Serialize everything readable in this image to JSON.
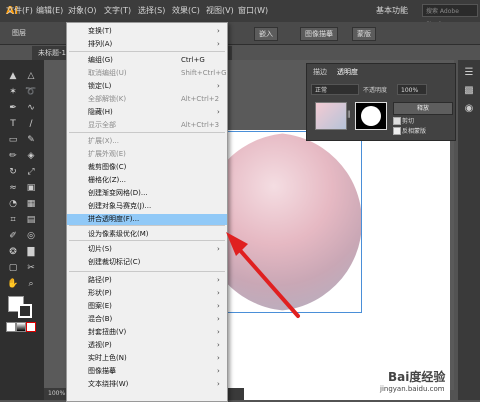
{
  "app": {
    "logo": "Ai"
  },
  "menubar": {
    "items": [
      "文件(F)",
      "编辑(E)",
      "对象(O)",
      "文字(T)",
      "选择(S)",
      "效果(C)",
      "视图(V)",
      "窗口(W)"
    ],
    "workspace": "基本功能",
    "search_placeholder": "搜索 Adobe Stock"
  },
  "control_bar": {
    "left_label": "图层",
    "embed_button": "嵌入",
    "trace_button": "图像描摹",
    "mask_button": "蒙版"
  },
  "document_tab": {
    "label": "未标题-1"
  },
  "transparency_panel": {
    "tabs": [
      "描边",
      "透明度"
    ],
    "blend_mode": "正常",
    "opacity_label": "不透明度",
    "opacity_value": "100%",
    "release_button": "释放",
    "clip_label": "剪切",
    "invert_label": "反相蒙版",
    "clip_checked": true,
    "invert_checked": false
  },
  "menu": {
    "items": [
      {
        "label": "变换(T)",
        "shortcut": "",
        "submenu": true,
        "disabled": false
      },
      {
        "label": "排列(A)",
        "shortcut": "",
        "submenu": true,
        "disabled": false
      },
      {
        "label": "编组(G)",
        "shortcut": "Ctrl+G",
        "submenu": false,
        "disabled": false
      },
      {
        "label": "取消编组(U)",
        "shortcut": "Shift+Ctrl+G",
        "submenu": false,
        "disabled": true
      },
      {
        "label": "锁定(L)",
        "shortcut": "",
        "submenu": true,
        "disabled": false
      },
      {
        "label": "全部解锁(K)",
        "shortcut": "Alt+Ctrl+2",
        "submenu": false,
        "disabled": true
      },
      {
        "label": "隐藏(H)",
        "shortcut": "",
        "submenu": true,
        "disabled": false
      },
      {
        "label": "显示全部",
        "shortcut": "Alt+Ctrl+3",
        "submenu": false,
        "disabled": true
      },
      {
        "label": "扩展(X)...",
        "shortcut": "",
        "submenu": false,
        "disabled": true
      },
      {
        "label": "扩展外观(E)",
        "shortcut": "",
        "submenu": false,
        "disabled": true
      },
      {
        "label": "裁剪图像(C)",
        "shortcut": "",
        "submenu": false,
        "disabled": false
      },
      {
        "label": "栅格化(Z)...",
        "shortcut": "",
        "submenu": false,
        "disabled": false
      },
      {
        "label": "创建渐变网格(D)...",
        "shortcut": "",
        "submenu": false,
        "disabled": false
      },
      {
        "label": "创建对象马赛克(J)...",
        "shortcut": "",
        "submenu": false,
        "disabled": false
      },
      {
        "label": "拼合透明度(F)...",
        "shortcut": "",
        "submenu": false,
        "disabled": false,
        "highlighted": true
      },
      {
        "label": "设为像素级优化(M)",
        "shortcut": "",
        "submenu": false,
        "disabled": false
      },
      {
        "label": "切片(S)",
        "shortcut": "",
        "submenu": true,
        "disabled": false
      },
      {
        "label": "创建裁切标记(C)",
        "shortcut": "",
        "submenu": false,
        "disabled": false
      },
      {
        "label": "路径(P)",
        "shortcut": "",
        "submenu": true,
        "disabled": false
      },
      {
        "label": "形状(P)",
        "shortcut": "",
        "submenu": true,
        "disabled": false
      },
      {
        "label": "图案(E)",
        "shortcut": "",
        "submenu": true,
        "disabled": false
      },
      {
        "label": "混合(B)",
        "shortcut": "",
        "submenu": true,
        "disabled": false
      },
      {
        "label": "封套扭曲(V)",
        "shortcut": "",
        "submenu": true,
        "disabled": false
      },
      {
        "label": "透视(P)",
        "shortcut": "",
        "submenu": true,
        "disabled": false
      },
      {
        "label": "实时上色(N)",
        "shortcut": "",
        "submenu": true,
        "disabled": false
      },
      {
        "label": "图像描摹",
        "shortcut": "",
        "submenu": true,
        "disabled": false
      },
      {
        "label": "文本绕排(W)",
        "shortcut": "",
        "submenu": true,
        "disabled": false
      }
    ]
  },
  "status_bar": {
    "zoom": "100%"
  },
  "watermark": {
    "brand": "Bai度经验",
    "url": "jingyan.baidu.com"
  },
  "colors": {
    "menu_highlight": "#91c9f7",
    "arrow": "#e02020",
    "logo": "#ff9a00"
  }
}
